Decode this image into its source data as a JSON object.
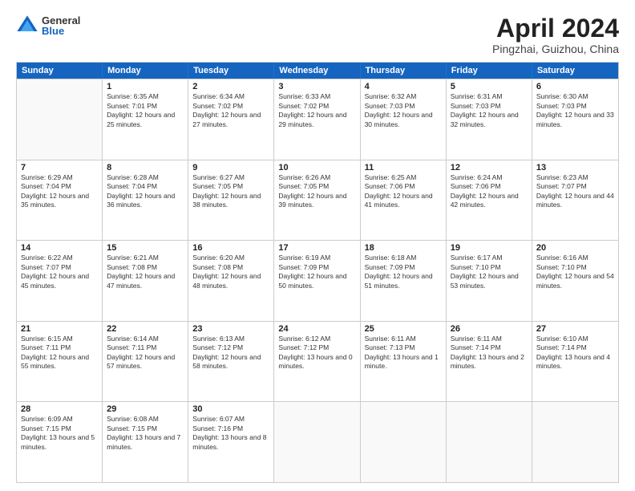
{
  "logo": {
    "general": "General",
    "blue": "Blue"
  },
  "title": "April 2024",
  "location": "Pingzhai, Guizhou, China",
  "days_of_week": [
    "Sunday",
    "Monday",
    "Tuesday",
    "Wednesday",
    "Thursday",
    "Friday",
    "Saturday"
  ],
  "weeks": [
    [
      {
        "day": "",
        "empty": true
      },
      {
        "day": "1",
        "sunrise": "6:35 AM",
        "sunset": "7:01 PM",
        "daylight": "12 hours and 25 minutes."
      },
      {
        "day": "2",
        "sunrise": "6:34 AM",
        "sunset": "7:02 PM",
        "daylight": "12 hours and 27 minutes."
      },
      {
        "day": "3",
        "sunrise": "6:33 AM",
        "sunset": "7:02 PM",
        "daylight": "12 hours and 29 minutes."
      },
      {
        "day": "4",
        "sunrise": "6:32 AM",
        "sunset": "7:03 PM",
        "daylight": "12 hours and 30 minutes."
      },
      {
        "day": "5",
        "sunrise": "6:31 AM",
        "sunset": "7:03 PM",
        "daylight": "12 hours and 32 minutes."
      },
      {
        "day": "6",
        "sunrise": "6:30 AM",
        "sunset": "7:03 PM",
        "daylight": "12 hours and 33 minutes."
      }
    ],
    [
      {
        "day": "7",
        "sunrise": "6:29 AM",
        "sunset": "7:04 PM",
        "daylight": "12 hours and 35 minutes."
      },
      {
        "day": "8",
        "sunrise": "6:28 AM",
        "sunset": "7:04 PM",
        "daylight": "12 hours and 36 minutes."
      },
      {
        "day": "9",
        "sunrise": "6:27 AM",
        "sunset": "7:05 PM",
        "daylight": "12 hours and 38 minutes."
      },
      {
        "day": "10",
        "sunrise": "6:26 AM",
        "sunset": "7:05 PM",
        "daylight": "12 hours and 39 minutes."
      },
      {
        "day": "11",
        "sunrise": "6:25 AM",
        "sunset": "7:06 PM",
        "daylight": "12 hours and 41 minutes."
      },
      {
        "day": "12",
        "sunrise": "6:24 AM",
        "sunset": "7:06 PM",
        "daylight": "12 hours and 42 minutes."
      },
      {
        "day": "13",
        "sunrise": "6:23 AM",
        "sunset": "7:07 PM",
        "daylight": "12 hours and 44 minutes."
      }
    ],
    [
      {
        "day": "14",
        "sunrise": "6:22 AM",
        "sunset": "7:07 PM",
        "daylight": "12 hours and 45 minutes."
      },
      {
        "day": "15",
        "sunrise": "6:21 AM",
        "sunset": "7:08 PM",
        "daylight": "12 hours and 47 minutes."
      },
      {
        "day": "16",
        "sunrise": "6:20 AM",
        "sunset": "7:08 PM",
        "daylight": "12 hours and 48 minutes."
      },
      {
        "day": "17",
        "sunrise": "6:19 AM",
        "sunset": "7:09 PM",
        "daylight": "12 hours and 50 minutes."
      },
      {
        "day": "18",
        "sunrise": "6:18 AM",
        "sunset": "7:09 PM",
        "daylight": "12 hours and 51 minutes."
      },
      {
        "day": "19",
        "sunrise": "6:17 AM",
        "sunset": "7:10 PM",
        "daylight": "12 hours and 53 minutes."
      },
      {
        "day": "20",
        "sunrise": "6:16 AM",
        "sunset": "7:10 PM",
        "daylight": "12 hours and 54 minutes."
      }
    ],
    [
      {
        "day": "21",
        "sunrise": "6:15 AM",
        "sunset": "7:11 PM",
        "daylight": "12 hours and 55 minutes."
      },
      {
        "day": "22",
        "sunrise": "6:14 AM",
        "sunset": "7:11 PM",
        "daylight": "12 hours and 57 minutes."
      },
      {
        "day": "23",
        "sunrise": "6:13 AM",
        "sunset": "7:12 PM",
        "daylight": "12 hours and 58 minutes."
      },
      {
        "day": "24",
        "sunrise": "6:12 AM",
        "sunset": "7:12 PM",
        "daylight": "13 hours and 0 minutes."
      },
      {
        "day": "25",
        "sunrise": "6:11 AM",
        "sunset": "7:13 PM",
        "daylight": "13 hours and 1 minute."
      },
      {
        "day": "26",
        "sunrise": "6:11 AM",
        "sunset": "7:14 PM",
        "daylight": "13 hours and 2 minutes."
      },
      {
        "day": "27",
        "sunrise": "6:10 AM",
        "sunset": "7:14 PM",
        "daylight": "13 hours and 4 minutes."
      }
    ],
    [
      {
        "day": "28",
        "sunrise": "6:09 AM",
        "sunset": "7:15 PM",
        "daylight": "13 hours and 5 minutes."
      },
      {
        "day": "29",
        "sunrise": "6:08 AM",
        "sunset": "7:15 PM",
        "daylight": "13 hours and 7 minutes."
      },
      {
        "day": "30",
        "sunrise": "6:07 AM",
        "sunset": "7:16 PM",
        "daylight": "13 hours and 8 minutes."
      },
      {
        "day": "",
        "empty": true
      },
      {
        "day": "",
        "empty": true
      },
      {
        "day": "",
        "empty": true
      },
      {
        "day": "",
        "empty": true
      }
    ]
  ],
  "labels": {
    "sunrise_prefix": "Sunrise: ",
    "sunset_prefix": "Sunset: ",
    "daylight_prefix": "Daylight: "
  }
}
